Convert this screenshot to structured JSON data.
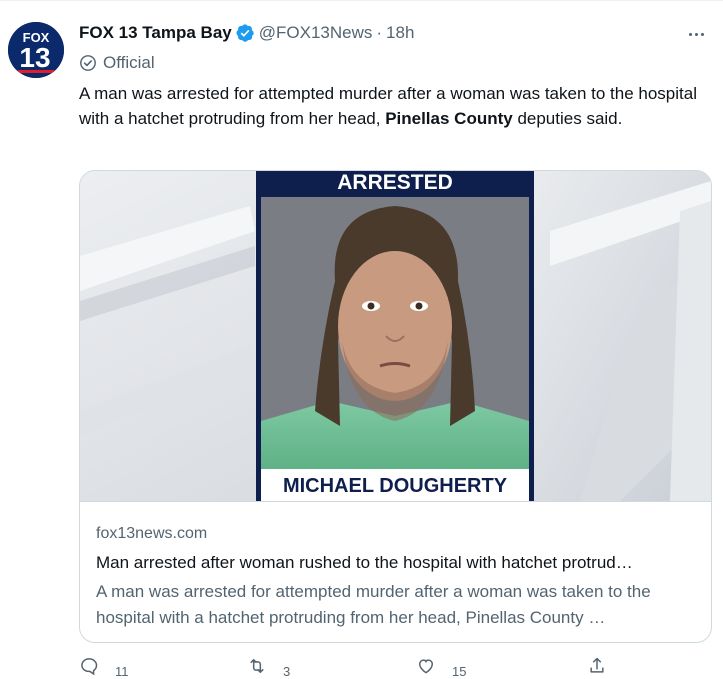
{
  "tweet": {
    "author_name": "FOX 13 Tampa Bay",
    "handle": "@FOX13News",
    "separator": "·",
    "time": "18h",
    "official_label": "Official",
    "text_before": "A man was arrested for attempted murder after a woman was taken to the hospital with a hatchet protruding from her head, ",
    "text_bold": "Pinellas County",
    "text_after": " deputies said."
  },
  "avatar": {
    "logo_line1": "FOX",
    "logo_line2": "13"
  },
  "card": {
    "image_banner": "ARRESTED",
    "image_caption": "MICHAEL DOUGHERTY",
    "domain": "fox13news.com",
    "title": "Man arrested after woman rushed to the hospital with hatchet protrud…",
    "description": "A man was arrested for attempted murder after a woman was taken to the hospital with a hatchet protruding from her head, Pinellas County …"
  },
  "actions": {
    "reply_count": "11",
    "retweet_count": "3",
    "like_count": "15"
  },
  "colors": {
    "verified": "#1d9bf0",
    "secondary_text": "#536471",
    "banner_navy": "#0f1f4d",
    "avatar_navy": "#0b2a6b"
  },
  "icons": {
    "more": "more-dots-icon",
    "verified": "verified-badge-icon",
    "official": "official-check-icon",
    "reply": "reply-icon",
    "retweet": "retweet-icon",
    "like": "heart-icon",
    "share": "share-icon"
  }
}
